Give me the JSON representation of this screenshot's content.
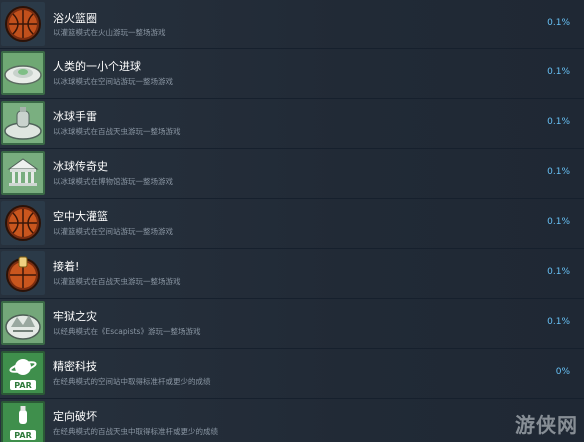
{
  "achievements": [
    {
      "title": "浴火篮圈",
      "desc": "以灌篮模式在火山游玩一整场游戏",
      "pct": "0.1%",
      "icon": "basketball-icon"
    },
    {
      "title": "人类的一小个进球",
      "desc": "以冰球模式在空间站游玩一整场游戏",
      "pct": "0.1%",
      "icon": "space-station-icon"
    },
    {
      "title": "冰球手雷",
      "desc": "以冰球模式在百战天虫游玩一整场游戏",
      "pct": "0.1%",
      "icon": "grenade-arena-icon"
    },
    {
      "title": "冰球传奇史",
      "desc": "以冰球模式在博物馆游玩一整场游戏",
      "pct": "0.1%",
      "icon": "museum-icon"
    },
    {
      "title": "空中大灌篮",
      "desc": "以灌篮模式在空间站游玩一整场游戏",
      "pct": "0.1%",
      "icon": "basketball-icon"
    },
    {
      "title": "接着!",
      "desc": "以灌篮模式在百战天虫游玩一整场游戏",
      "pct": "0.1%",
      "icon": "basketball-trophy-icon"
    },
    {
      "title": "牢狱之灾",
      "desc": "以经典模式在《Escapists》游玩一整场游戏",
      "pct": "0.1%",
      "icon": "prison-icon"
    },
    {
      "title": "精密科技",
      "desc": "在经典模式的空间站中取得标准杆或更少的成绩",
      "pct": "0%",
      "icon": "par-planet-icon"
    },
    {
      "title": "定向破坏",
      "desc": "在经典模式的百战天虫中取得标准杆或更少的成绩",
      "pct": "",
      "icon": "par-grenade-icon"
    }
  ],
  "watermark": "游侠网"
}
